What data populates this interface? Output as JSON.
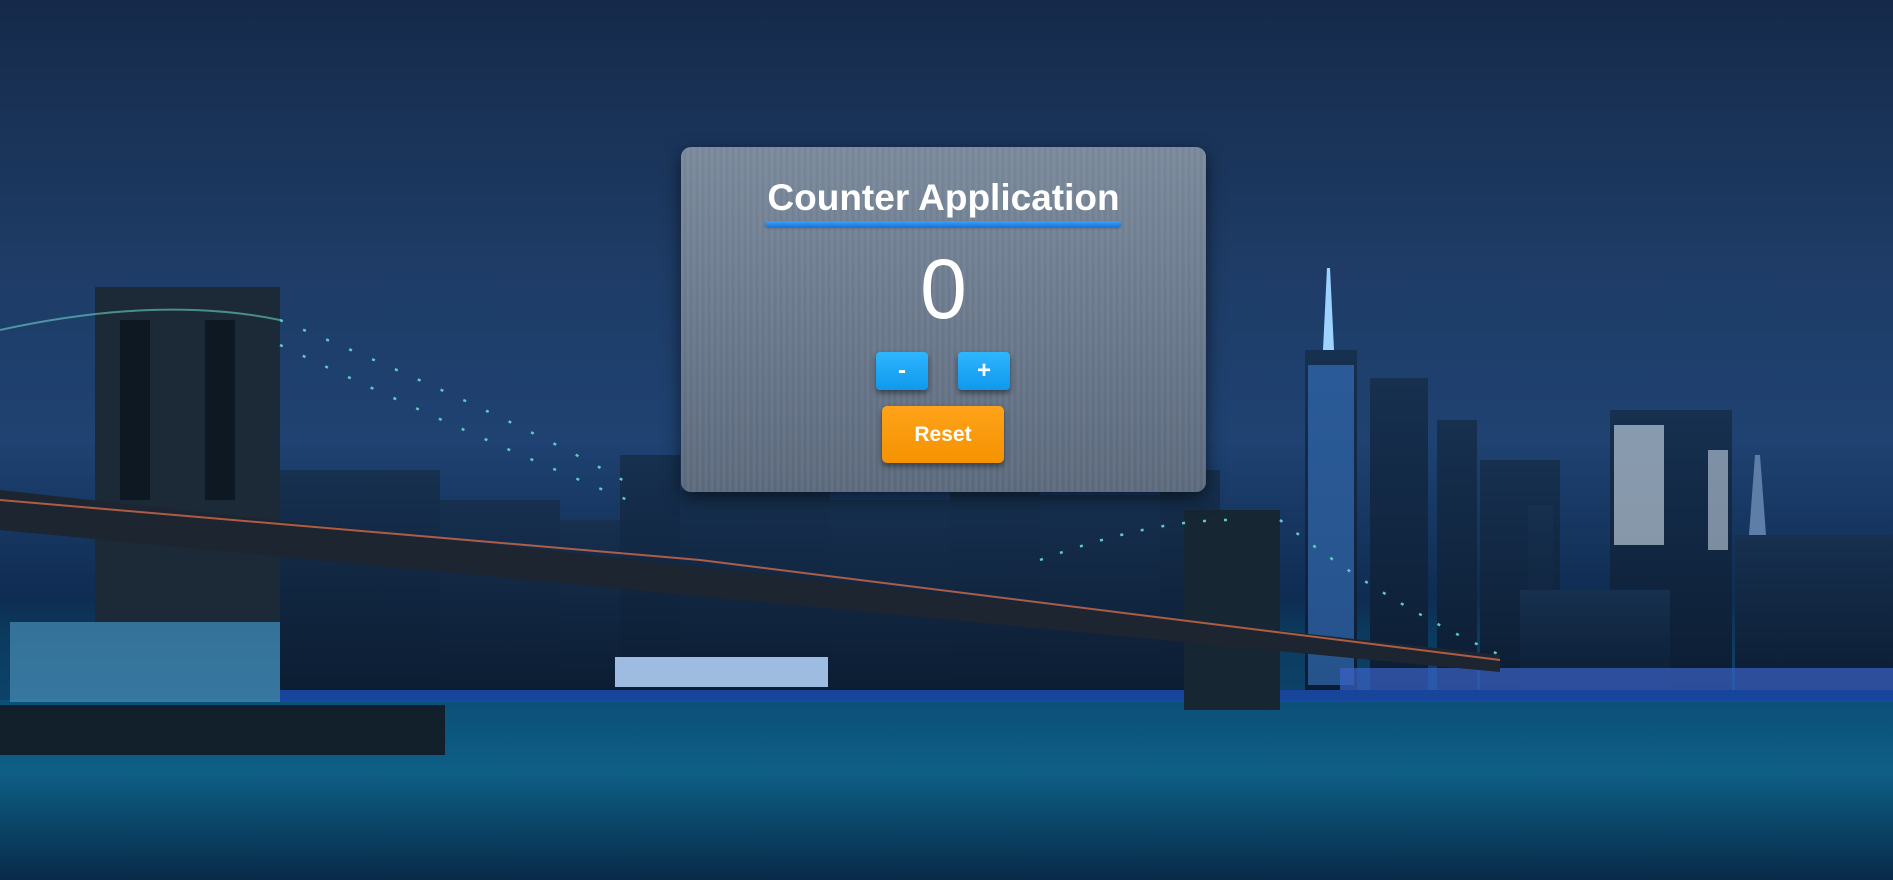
{
  "app": {
    "title": "Counter Application",
    "count": "0"
  },
  "controls": {
    "decrement_label": "-",
    "increment_label": "+",
    "reset_label": "Reset"
  },
  "colors": {
    "step_button": "#1aa6f5",
    "reset_button": "#ff9a0a",
    "title_underline": "#2a8ee8",
    "card": "#6f7e91"
  }
}
